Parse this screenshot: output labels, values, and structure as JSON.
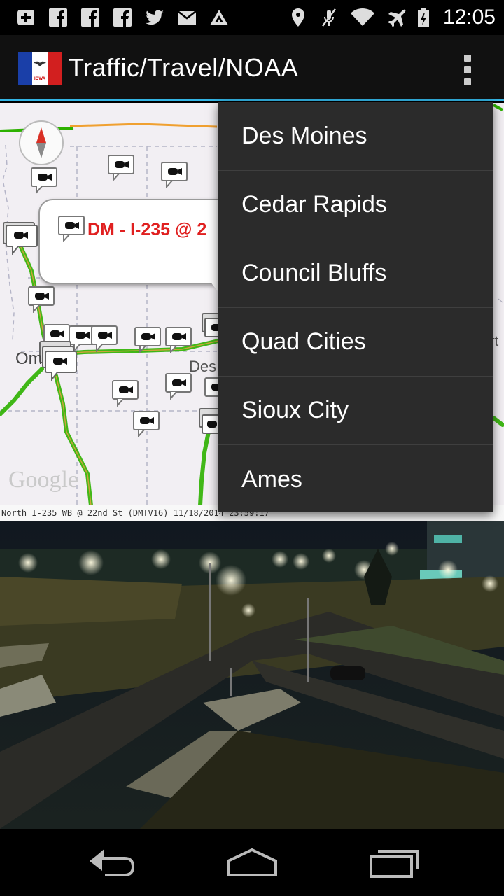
{
  "status_bar": {
    "time": "12:05",
    "left_icons": [
      "add-box-icon",
      "facebook-icon",
      "facebook-icon",
      "facebook-icon",
      "twitter-icon",
      "mail-icon",
      "triangle-logo-icon"
    ],
    "right_icons": [
      "location-icon",
      "mute-icon",
      "wifi-icon",
      "airplane-icon",
      "battery-icon"
    ]
  },
  "action_bar": {
    "title": "Traffic/Travel/NOAA",
    "logo": "iowa-flag-icon",
    "logo_text": "IOWA",
    "overflow": "overflow-menu-icon"
  },
  "map": {
    "callout_text": "DM - I-235 @ 2",
    "labels": {
      "omaha": "Om",
      "des_moines": "Des",
      "right_edge": "rt"
    },
    "google": "Google",
    "compass": "compass-icon"
  },
  "camera_feed": {
    "caption": "North      I-235 WB @ 22nd St (DMTV16) 11/18/2014 23:59:17"
  },
  "menu": {
    "items": [
      {
        "label": "Des Moines"
      },
      {
        "label": "Cedar Rapids"
      },
      {
        "label": "Council Bluffs"
      },
      {
        "label": "Quad Cities"
      },
      {
        "label": "Sioux City"
      },
      {
        "label": "Ames"
      }
    ]
  },
  "nav_bar": {
    "buttons": [
      "back-icon",
      "home-icon",
      "recent-apps-icon"
    ]
  },
  "colors": {
    "accent": "#33b5e5",
    "menu_bg": "#2b2b2b",
    "callout_text": "#e02020",
    "road_green": "#2db100",
    "road_orange": "#f0a030"
  }
}
